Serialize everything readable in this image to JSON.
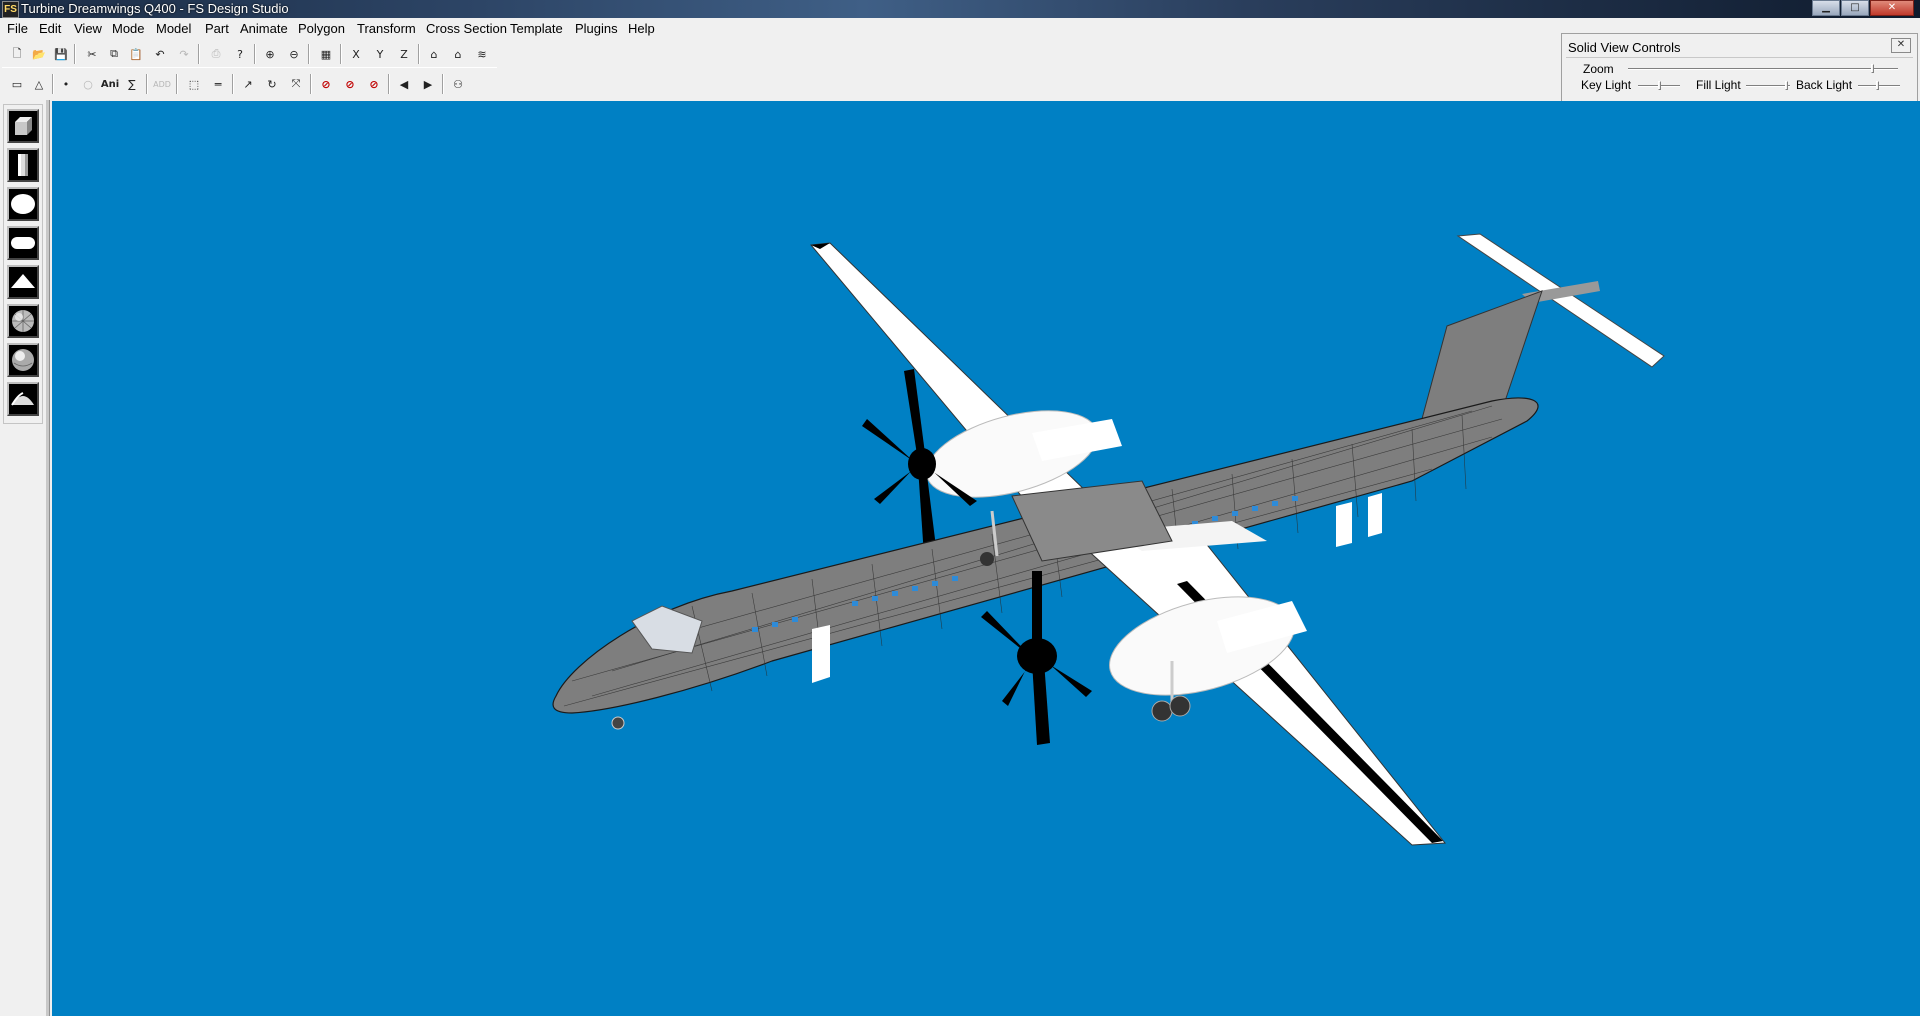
{
  "window": {
    "title": "Turbine Dreamwings Q400 - FS Design Studio",
    "app_icon": "FS",
    "buttons": {
      "minimize": "▁",
      "maximize": "□",
      "close": "✕"
    }
  },
  "menu": [
    "File",
    "Edit",
    "View",
    "Mode",
    "Model",
    "Part",
    "Animate",
    "Polygon",
    "Transform",
    "Cross Section",
    "Template",
    "Plugins",
    "Help"
  ],
  "toolbar1": [
    {
      "name": "new-icon",
      "glyph": "🗋"
    },
    {
      "name": "open-icon",
      "glyph": "📂"
    },
    {
      "name": "save-icon",
      "glyph": "💾"
    },
    {
      "name": "cut-icon",
      "glyph": "✂"
    },
    {
      "name": "copy-icon",
      "glyph": "⧉"
    },
    {
      "name": "paste-icon",
      "glyph": "📋"
    },
    {
      "name": "undo-icon",
      "glyph": "↶"
    },
    {
      "name": "redo-icon",
      "glyph": "↷"
    },
    {
      "name": "print-icon",
      "glyph": "⎙"
    },
    {
      "name": "help-icon",
      "glyph": "?"
    },
    {
      "name": "zoom-in-icon",
      "glyph": "⊕"
    },
    {
      "name": "zoom-out-icon",
      "glyph": "⊖"
    },
    {
      "name": "grid-icon",
      "glyph": "▦"
    },
    {
      "name": "view-x-icon",
      "glyph": "X"
    },
    {
      "name": "view-y-icon",
      "glyph": "Y"
    },
    {
      "name": "view-z-icon",
      "glyph": "Z"
    },
    {
      "name": "wireframe-icon",
      "glyph": "⌂"
    },
    {
      "name": "house-icon",
      "glyph": "⌂"
    },
    {
      "name": "render-icon",
      "glyph": "≋"
    }
  ],
  "toolbar2": [
    {
      "name": "select-box-icon",
      "glyph": "▭"
    },
    {
      "name": "triangle-icon",
      "glyph": "△"
    },
    {
      "name": "point-icon",
      "glyph": "•"
    },
    {
      "name": "circle-icon",
      "glyph": "○"
    },
    {
      "name": "animation-icon",
      "glyph": "Ani"
    },
    {
      "name": "sum-icon",
      "glyph": "∑"
    },
    {
      "name": "add-icon",
      "glyph": "ADD"
    },
    {
      "name": "marquee-icon",
      "glyph": "⬚"
    },
    {
      "name": "ruler-icon",
      "glyph": "═"
    },
    {
      "name": "arrow-icon",
      "glyph": "↗"
    },
    {
      "name": "rotate-icon",
      "glyph": "↻"
    },
    {
      "name": "scale-icon",
      "glyph": "⤧"
    },
    {
      "name": "no-x-icon",
      "glyph": "⊘"
    },
    {
      "name": "no-y-icon",
      "glyph": "⊘"
    },
    {
      "name": "no-z-icon",
      "glyph": "⊘"
    },
    {
      "name": "prev-icon",
      "glyph": "◀"
    },
    {
      "name": "next-icon",
      "glyph": "▶"
    },
    {
      "name": "binoculars-icon",
      "glyph": "⚇"
    }
  ],
  "solid_view_controls": {
    "title": "Solid View Controls",
    "close": "✕",
    "zoom_label": "Zoom",
    "key_light_label": "Key Light",
    "fill_light_label": "Fill Light",
    "back_light_label": "Back Light"
  },
  "palette": [
    {
      "name": "cube-primitive-icon"
    },
    {
      "name": "cylinder-primitive-icon"
    },
    {
      "name": "sphere-primitive-icon"
    },
    {
      "name": "capsule-primitive-icon"
    },
    {
      "name": "cone-primitive-icon"
    },
    {
      "name": "geosphere-primitive-icon"
    },
    {
      "name": "shaded-sphere-primitive-icon"
    },
    {
      "name": "dome-primitive-icon"
    }
  ],
  "colors": {
    "viewport_bg": "#0080c4",
    "fuselage": "#7e7e7e",
    "wing": "#ffffff",
    "wireframe": "#1a1a1a"
  }
}
